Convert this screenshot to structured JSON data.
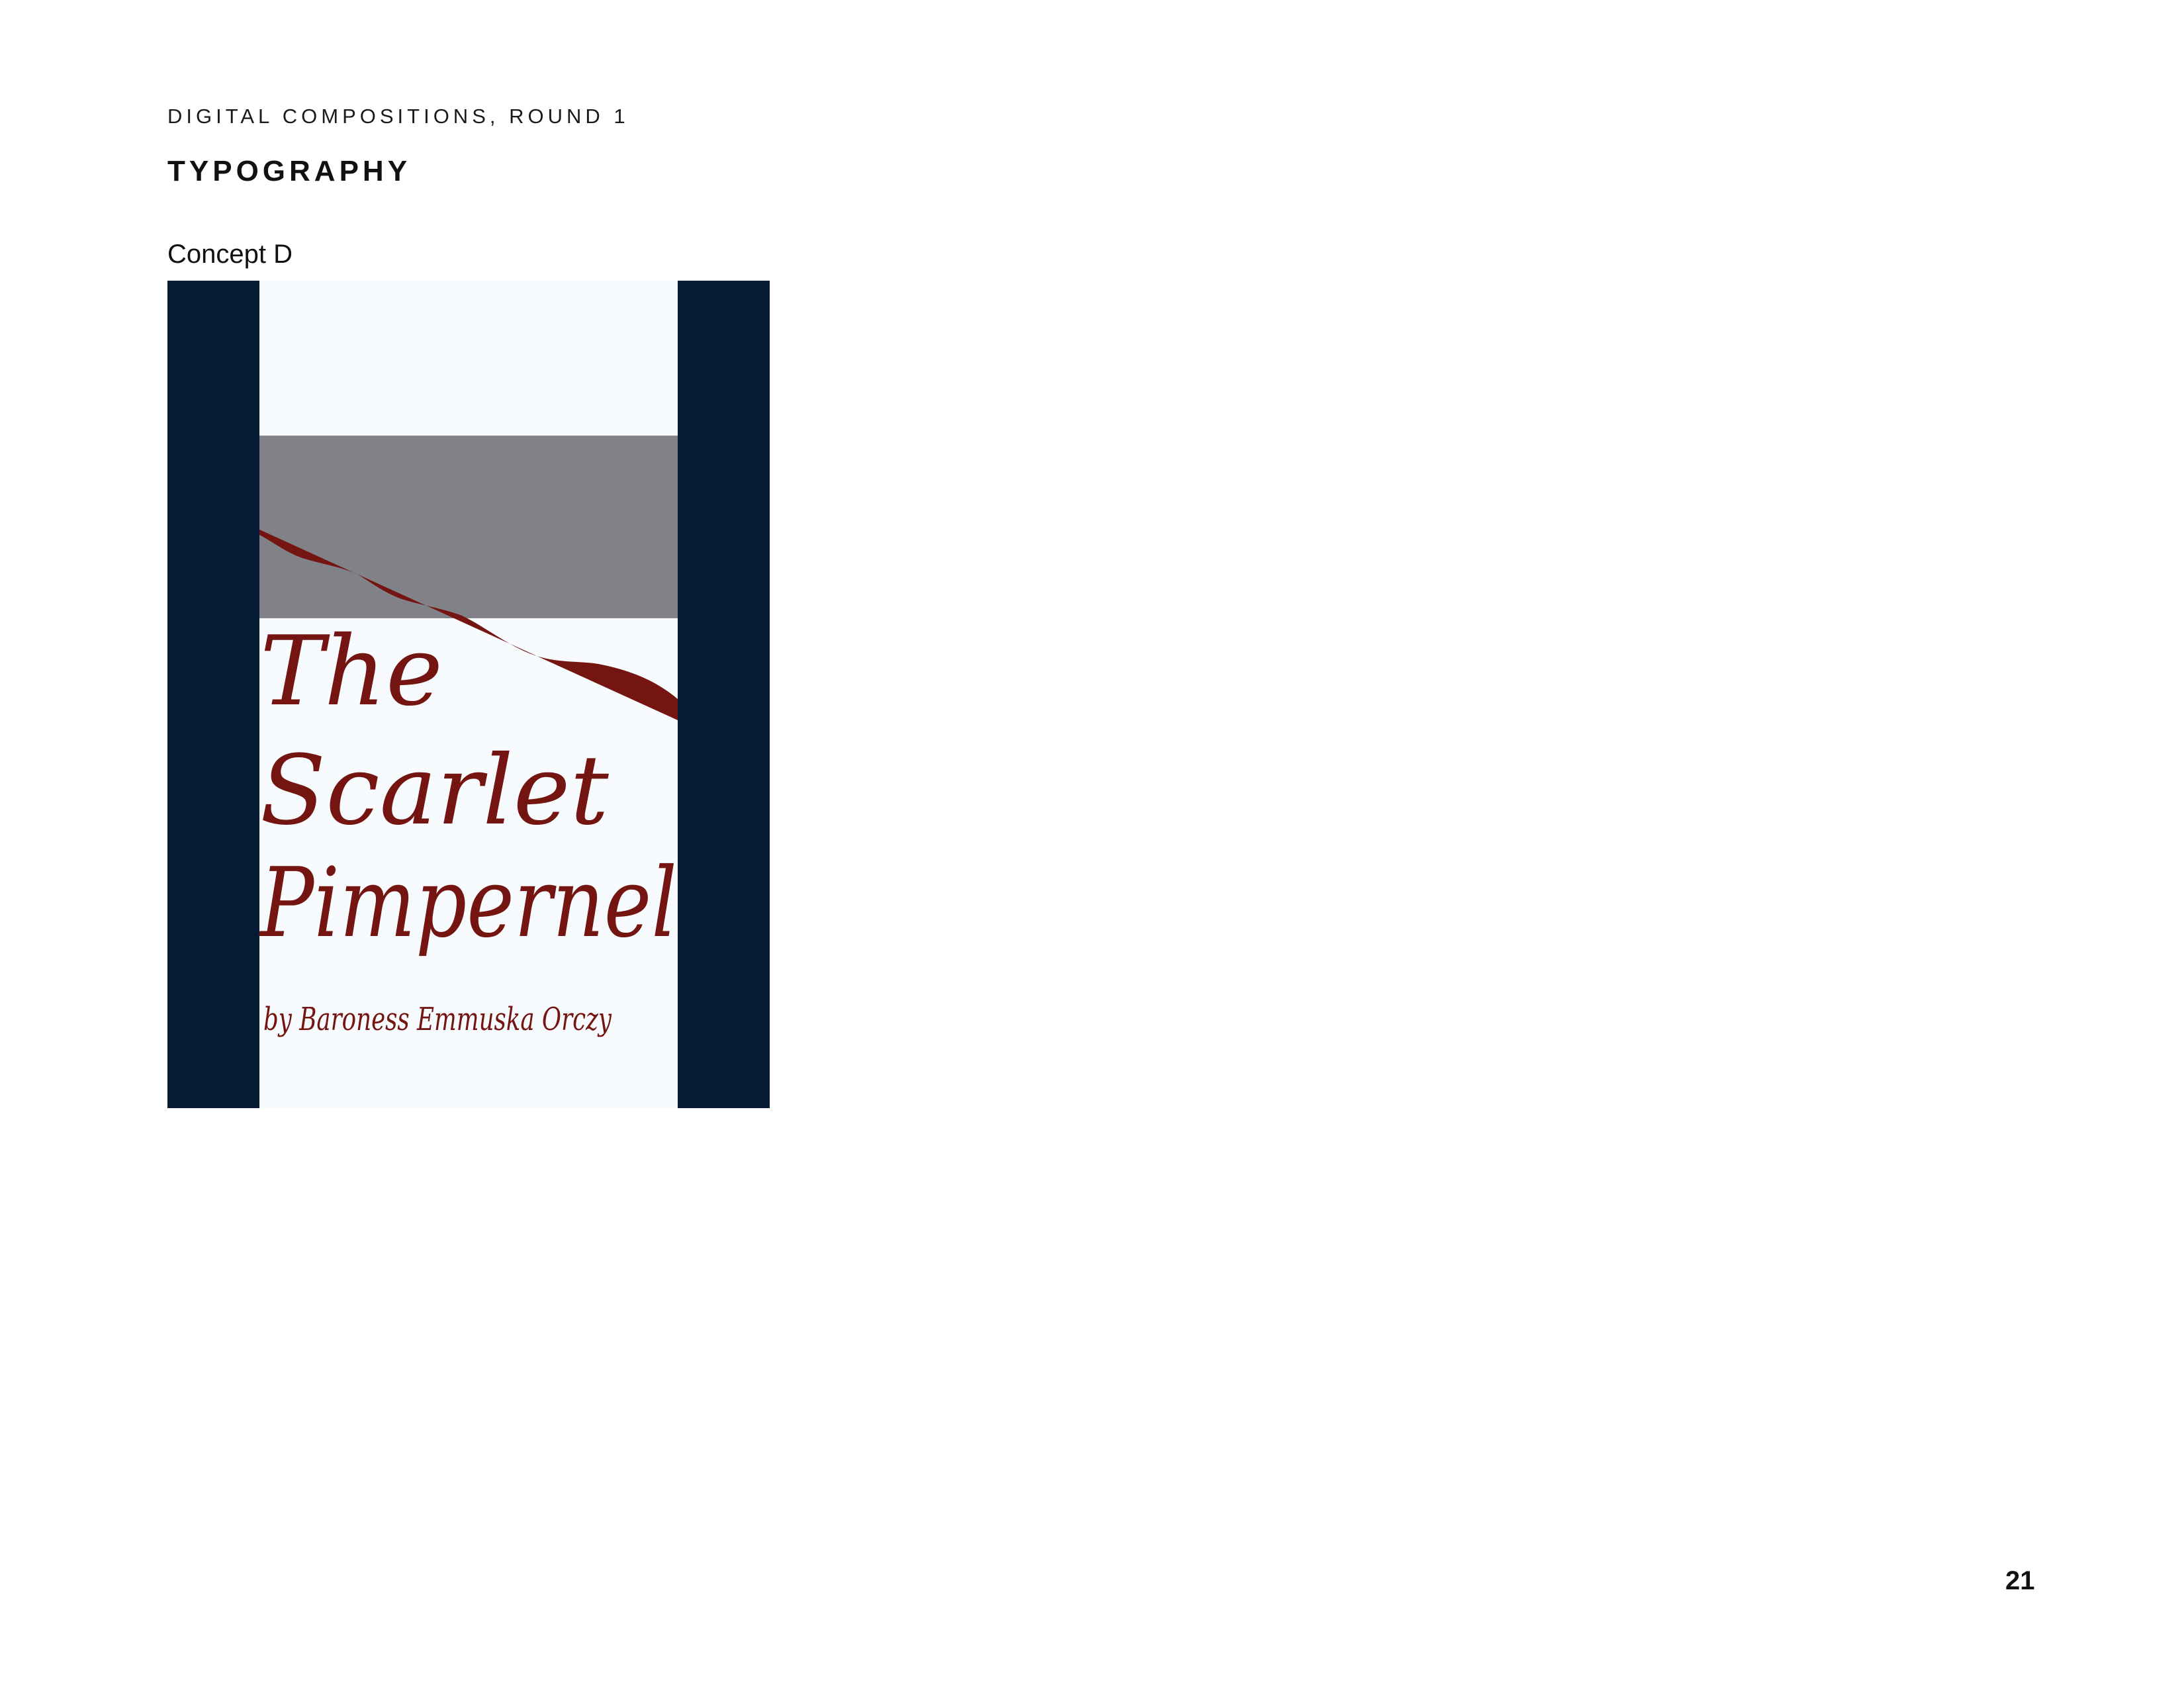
{
  "header": {
    "section_label": "DIGITAL COMPOSITIONS, ROUND 1",
    "section_title": "TYPOGRAPHY"
  },
  "concept": {
    "label": "Concept D"
  },
  "cover": {
    "title_line_1": "The",
    "title_line_2": "Scarlet",
    "title_line_3": "Pimpernel",
    "byline": "by Baroness Emmuska Orczy",
    "colors": {
      "side_panels": "#061a33",
      "background": "#f7fbfd",
      "sky_block": "#818287",
      "red_band": "#751512",
      "title_text": "#751512"
    }
  },
  "footer": {
    "page_number": "21"
  }
}
